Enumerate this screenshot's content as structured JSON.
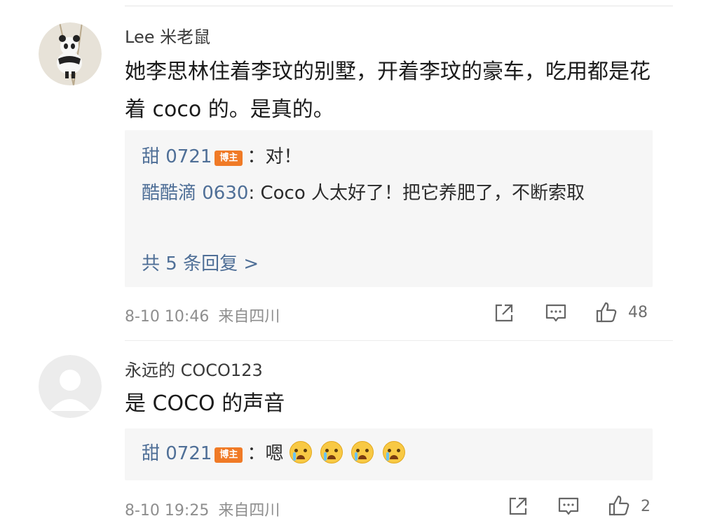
{
  "comments": [
    {
      "username": "Lee 米老鼠",
      "avatar": "panda-avatar",
      "content": "她李思林住着李玟的别墅，开着李玟的豪车，吃用都是花着 coco 的。是真的。",
      "replies": [
        {
          "name": "甜 0721",
          "badge": "博主",
          "text": "：对！"
        },
        {
          "name": "酷酷滴 0630",
          "badge": "",
          "text": ": Coco 人太好了！把它养肥了，不断索取"
        }
      ],
      "more_replies": "共 5 条回复 >",
      "date": "8-10 10:46",
      "location": "来自四川",
      "likes": "48"
    },
    {
      "username": "永远的 COCO123",
      "avatar": "default-avatar",
      "content": "是 COCO 的声音",
      "replies": [
        {
          "name": "甜 0721",
          "badge": "博主",
          "text": "：嗯"
        }
      ],
      "emoji_count": 4,
      "date": "8-10 19:25",
      "location": "来自四川",
      "likes": "2"
    }
  ],
  "icons": [
    "share-icon",
    "comment-icon",
    "like-icon",
    "crying-emoji-icon"
  ],
  "colors": {
    "name_blue": "#4f6f97",
    "badge_orange": "#f07a26",
    "reply_bg": "#f6f6f6",
    "meta_gray": "#8e8e8e"
  }
}
